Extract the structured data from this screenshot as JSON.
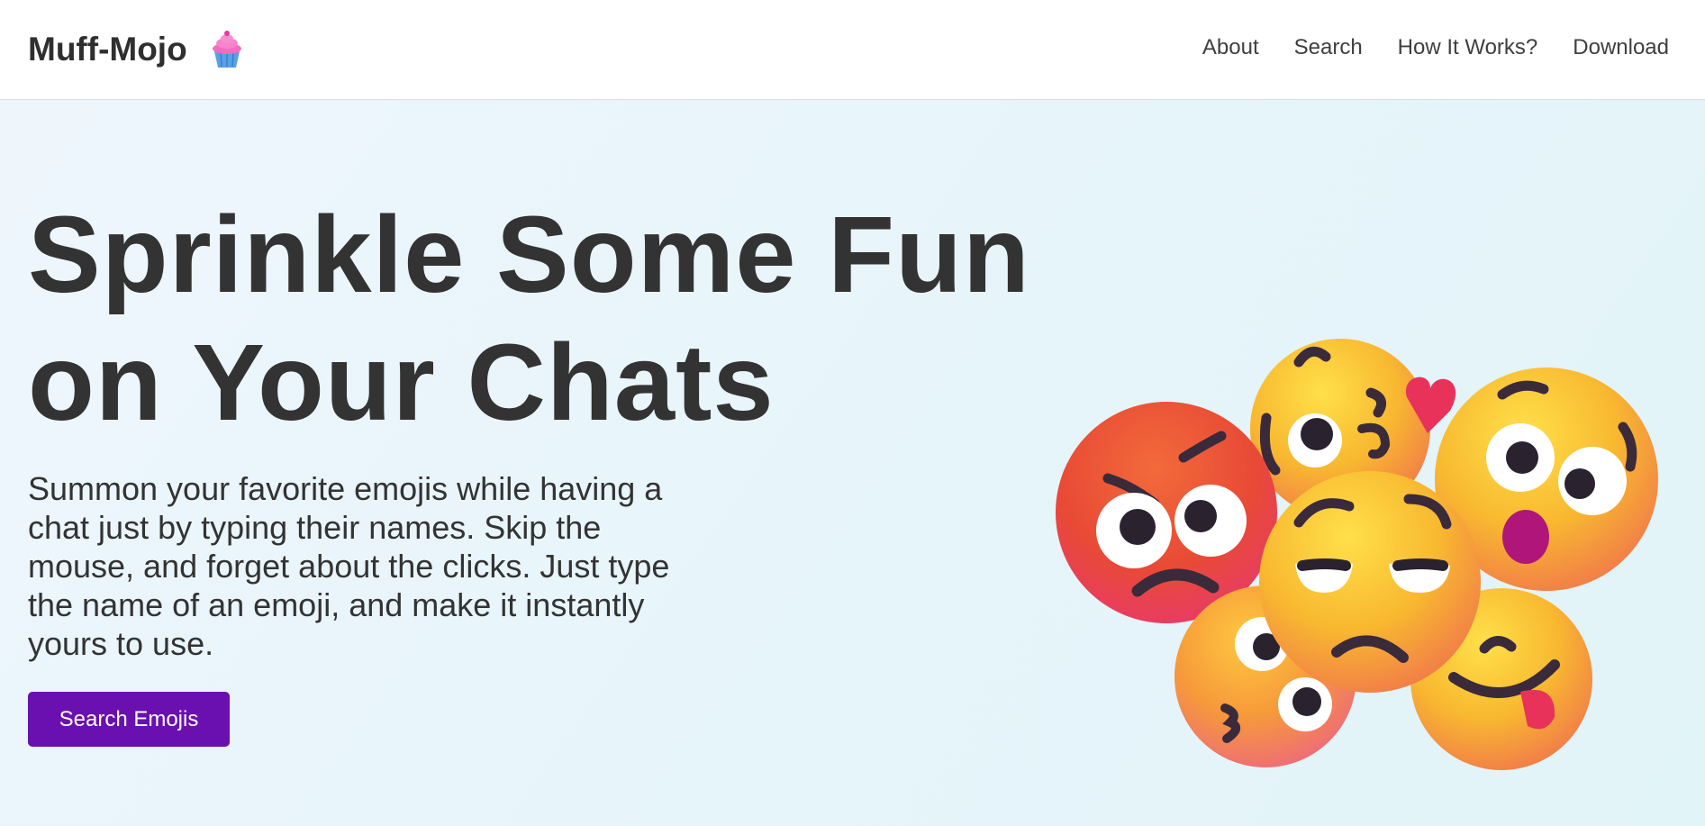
{
  "nav": {
    "brand": "Muff-Mojo",
    "brand_icon": "cupcake-icon",
    "links": [
      "About",
      "Search",
      "How It Works?",
      "Download"
    ]
  },
  "hero": {
    "headline_line1": "Sprinkle Some Fun",
    "headline_line2": "on Your Chats",
    "description": "Summon your favorite emojis while having a chat just by typing their names. Skip the mouse, and forget about the clicks. Just type the name of an emoji, and make it instantly yours to use.",
    "cta_label": "Search Emojis",
    "illustration": "emoji-cluster-illustration"
  },
  "colors": {
    "accent": "#6a10b0",
    "text": "#333333",
    "hero_bg": "#e8f5fb"
  }
}
